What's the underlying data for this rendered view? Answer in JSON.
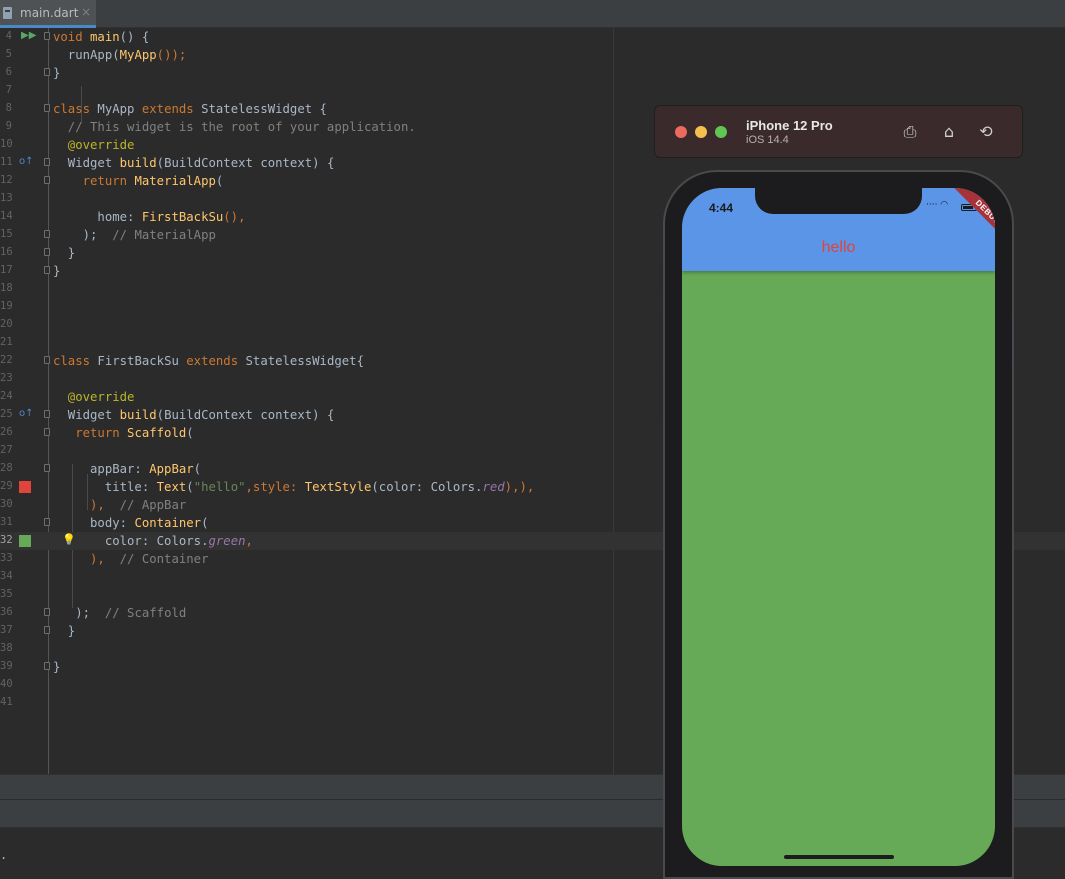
{
  "tab": {
    "label": "main.dart",
    "close": "×"
  },
  "editor": {
    "lines": [
      {
        "n": "4",
        "html_key": "l4"
      },
      {
        "n": "5"
      },
      {
        "n": "6"
      },
      {
        "n": "7"
      },
      {
        "n": "8"
      },
      {
        "n": "9"
      },
      {
        "n": "10"
      },
      {
        "n": "11"
      },
      {
        "n": "12"
      },
      {
        "n": "13"
      },
      {
        "n": "14"
      },
      {
        "n": "15"
      },
      {
        "n": "16"
      },
      {
        "n": "17"
      },
      {
        "n": "18"
      },
      {
        "n": "19"
      },
      {
        "n": "20"
      },
      {
        "n": "21"
      },
      {
        "n": "22"
      },
      {
        "n": "23"
      },
      {
        "n": "24"
      },
      {
        "n": "25"
      },
      {
        "n": "26"
      },
      {
        "n": "27"
      },
      {
        "n": "28"
      },
      {
        "n": "29"
      },
      {
        "n": "30"
      },
      {
        "n": "31"
      },
      {
        "n": "32"
      },
      {
        "n": "33"
      },
      {
        "n": "34"
      },
      {
        "n": "35"
      },
      {
        "n": "36"
      },
      {
        "n": "37"
      },
      {
        "n": "38"
      },
      {
        "n": "39"
      },
      {
        "n": "40"
      },
      {
        "n": "41"
      }
    ],
    "code": {
      "l4_kw": "void",
      "l4_fn": "main",
      "l4_rest": "() {",
      "l5_a": "  runApp(",
      "l5_fn": "MyApp",
      "l5_b": "());",
      "l6": "}",
      "l8_kw1": "class",
      "l8_name": " MyApp ",
      "l8_kw2": "extends",
      "l8_rest": " StatelessWidget {",
      "l9": "  // This widget is the root of your application.",
      "l10": "  @override",
      "l11_a": "  Widget ",
      "l11_fn": "build",
      "l11_b": "(BuildContext context) {",
      "l12_kw": "    return",
      "l12_fn": " MaterialApp",
      "l12_b": "(",
      "l14_a": "      home: ",
      "l14_fn": "FirstBackSu",
      "l14_b": "(),",
      "l15_a": "    );",
      "l15_cm": "  // MaterialApp",
      "l16": "  }",
      "l17": "}",
      "l22_kw1": "class",
      "l22_name": " FirstBackSu ",
      "l22_kw2": "extends",
      "l22_rest": " StatelessWidget{",
      "l24": "  @override",
      "l25_a": "  Widget ",
      "l25_fn": "build",
      "l25_b": "(BuildContext context) {",
      "l26_kw": "   return",
      "l26_fn": " Scaffold",
      "l26_b": "(",
      "l28_a": "     appBar: ",
      "l28_fn": "AppBar",
      "l28_b": "(",
      "l29_a": "       title: ",
      "l29_fn": "Text",
      "l29_b": "(",
      "l29_st": "\"hello\"",
      "l29_c": ",style: ",
      "l29_fn2": "TextStyle",
      "l29_d": "(color: Colors.",
      "l29_it": "red",
      "l29_e": "),),",
      "l30_a": "     ),",
      "l30_cm": "  // AppBar",
      "l31_a": "     body: ",
      "l31_fn": "Container",
      "l31_b": "(",
      "l32_a": "       color: Colors.",
      "l32_it": "green",
      "l32_b": ",",
      "l33_a": "     ),",
      "l33_cm": "  // Container",
      "l36_a": "   );",
      "l36_cm": "  // Scaffold",
      "l37": "  }",
      "l39": "}"
    },
    "swatch_colors": {
      "red": "#e0443a",
      "green": "#66aa58"
    }
  },
  "console": {
    "text": "."
  },
  "simulator": {
    "device_name": "iPhone 12 Pro",
    "os_version": "iOS 14.4",
    "buttons": {
      "screenshot": "screenshot-icon",
      "home": "home-icon",
      "rotate": "rotate-icon"
    },
    "time": "4:44",
    "app_title": "hello",
    "debug_banner": "DEBUG",
    "appbar_color": "#5b95e8",
    "body_color": "#66aa58"
  }
}
